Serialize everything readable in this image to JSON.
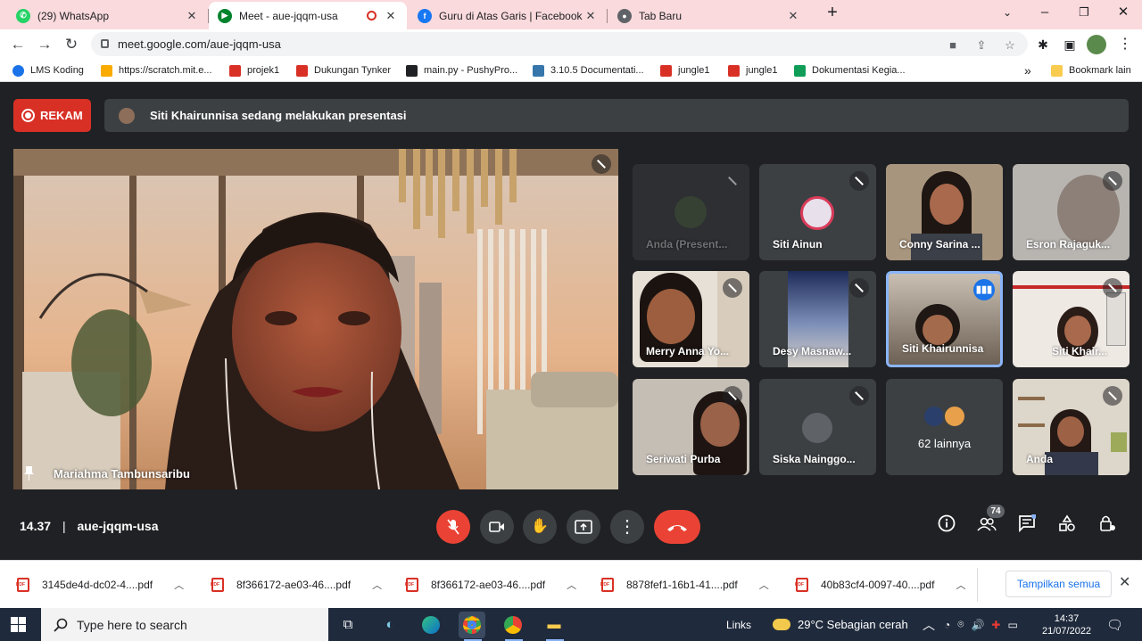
{
  "browser": {
    "tabs": [
      {
        "title": "(29) WhatsApp",
        "favicon": "whatsapp-icon",
        "color": "#25d366",
        "active": false
      },
      {
        "title": "Meet - aue-jqqm-usa",
        "favicon": "meet-icon",
        "color": "#00832d",
        "active": true
      },
      {
        "title": "Guru di Atas Garis | Facebook",
        "favicon": "facebook-icon",
        "color": "#1877f2",
        "active": false
      },
      {
        "title": "Tab Baru",
        "favicon": "chrome-icon",
        "color": "#5f6368",
        "active": false
      }
    ],
    "url": "meet.google.com/aue-jqqm-usa",
    "bookmarks": [
      {
        "label": "LMS Koding",
        "color": "#1a73e8"
      },
      {
        "label": "https://scratch.mit.e...",
        "color": "#f9ab00"
      },
      {
        "label": "projek1",
        "color": "#d93025"
      },
      {
        "label": "Dukungan Tynker",
        "color": "#d93025"
      },
      {
        "label": "main.py - PushyPro...",
        "color": "#202124"
      },
      {
        "label": "3.10.5 Documentati...",
        "color": "#3776ab"
      },
      {
        "label": "jungle1",
        "color": "#d93025"
      },
      {
        "label": "jungle1",
        "color": "#d93025"
      },
      {
        "label": "Dokumentasi Kegia...",
        "color": "#0f9d58"
      }
    ],
    "bookmarks_more": "»",
    "other_bookmarks": "Bookmark lain"
  },
  "meet": {
    "record_label": "REKAM",
    "presenting_text": "Siti Khairunnisa sedang melakukan presentasi",
    "main_speaker": "Mariahma Tambunsaribu",
    "participants": [
      {
        "name": "Anda (Present...",
        "bg": "#2d2f32",
        "dim": true
      },
      {
        "name": "Siti Ainun",
        "bg": "#3c4043"
      },
      {
        "name": "Conny Sarina ...",
        "bg": "#9a8a78"
      },
      {
        "name": "Esron Rajaguk...",
        "bg": "#b7b4b0"
      },
      {
        "name": "Merry Anna Yo...",
        "bg": "#6b5a4c"
      },
      {
        "name": "Desy Masnaw...",
        "bg": "#4a5a7c"
      },
      {
        "name": "Siti Khairunnisa",
        "bg": "#7b6f62",
        "speaking": true
      },
      {
        "name": "Siti Khair...",
        "bg": "#8a8580"
      },
      {
        "name": "Seriwati Purba",
        "bg": "#bdb6ae"
      },
      {
        "name": "Siska Nainggo...",
        "bg": "#3c4043"
      },
      {
        "name": "62 lainnya",
        "bg": "#3c4043"
      },
      {
        "name": "Anda",
        "bg": "#d7d0c4"
      }
    ],
    "time": "14.37",
    "separator": "|",
    "meeting_code": "aue-jqqm-usa",
    "participant_count": "74"
  },
  "downloads": {
    "items": [
      "3145de4d-dc02-4....pdf",
      "8f366172-ae03-46....pdf",
      "8f366172-ae03-46....pdf",
      "8878fef1-16b1-41....pdf",
      "40b83cf4-0097-40....pdf"
    ],
    "show_all": "Tampilkan semua"
  },
  "taskbar": {
    "search_placeholder": "Type here to search",
    "links": "Links",
    "weather": "29°C  Sebagian cerah",
    "clock_time": "14:37",
    "clock_date": "21/07/2022"
  }
}
